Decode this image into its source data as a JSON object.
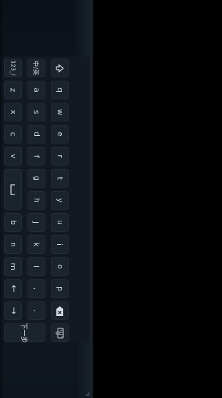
{
  "keyboard": {
    "top_row": {
      "shift": "⇧",
      "letters": [
        "q",
        "w",
        "e",
        "r",
        "t",
        "y",
        "u",
        "i",
        "o",
        "p"
      ],
      "backspace": "⌫"
    },
    "middle_row": {
      "lang_toggle": "中/英",
      "letters": [
        "a",
        "s",
        "d",
        "f",
        "g",
        "h",
        "j",
        "k",
        "l"
      ],
      "comma": ",",
      "period": "."
    },
    "bottom_row": {
      "numeric_toggle": "123_/",
      "letters_left": [
        "z",
        "x",
        "c",
        "v"
      ],
      "space": "␣",
      "letters_right": [
        "b",
        "n",
        "m"
      ],
      "arrow_left": "←",
      "arrow_right": "→"
    },
    "aux": {
      "confirm": "下一步",
      "hide_keyboard": "⌨"
    }
  },
  "colors": {
    "key_bg": "#1b232d",
    "key_text": "#d7dce3",
    "panel_bg": "#111923"
  }
}
